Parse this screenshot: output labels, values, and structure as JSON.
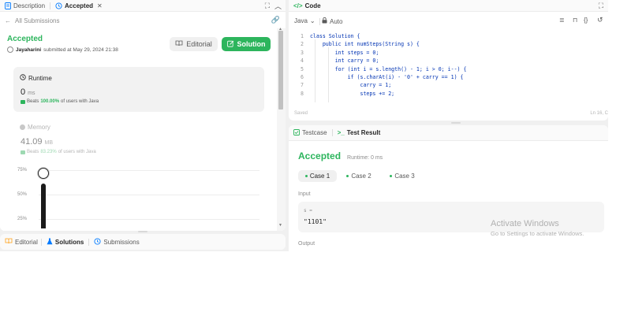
{
  "left_tabs": {
    "description": "Description",
    "accepted": "Accepted"
  },
  "back_link": "All Submissions",
  "submission": {
    "status": "Accepted",
    "author": "Jayaharini",
    "submitted_text": "submitted at May 29, 2024 21:38",
    "editorial_btn": "Editorial",
    "solution_btn": "Solution"
  },
  "runtime": {
    "label": "Runtime",
    "value": "0",
    "unit": "ms",
    "beats_prefix": "Beats",
    "beats_value": "100.00%",
    "beats_suffix": "of users with Java"
  },
  "memory": {
    "label": "Memory",
    "value": "41.09",
    "unit": "MB",
    "beats_prefix": "Beats",
    "beats_value": "83.23%",
    "beats_suffix": "of users with Java"
  },
  "chart": {
    "ticks": [
      "75%",
      "50%",
      "25%"
    ]
  },
  "bottom_tabs": {
    "editorial": "Editorial",
    "solutions": "Solutions",
    "submissions": "Submissions"
  },
  "code_panel": {
    "title": "Code",
    "language": "Java",
    "mode": "Auto",
    "saved": "Saved",
    "cursor": "Ln 16, C",
    "lines": [
      "class Solution {",
      "    public int numSteps(String s) {",
      "        int steps = 0;",
      "        int carry = 0;",
      "        for (int i = s.length() - 1; i > 0; i--) {",
      "            if (s.charAt(i) - '0' + carry == 1) {",
      "                carry = 1;",
      "                steps += 2;"
    ]
  },
  "test_panel": {
    "testcase_tab": "Testcase",
    "result_tab": "Test Result",
    "status": "Accepted",
    "runtime_text": "Runtime: 0 ms",
    "cases": [
      "Case 1",
      "Case 2",
      "Case 3"
    ],
    "input_label": "Input",
    "var_name": "s =",
    "var_value": "\"1101\"",
    "output_label": "Output"
  },
  "watermark": {
    "title": "Activate Windows",
    "subtitle": "Go to Settings to activate Windows."
  },
  "colors": {
    "accent_green": "#2db55d",
    "link_blue": "#007aff"
  }
}
